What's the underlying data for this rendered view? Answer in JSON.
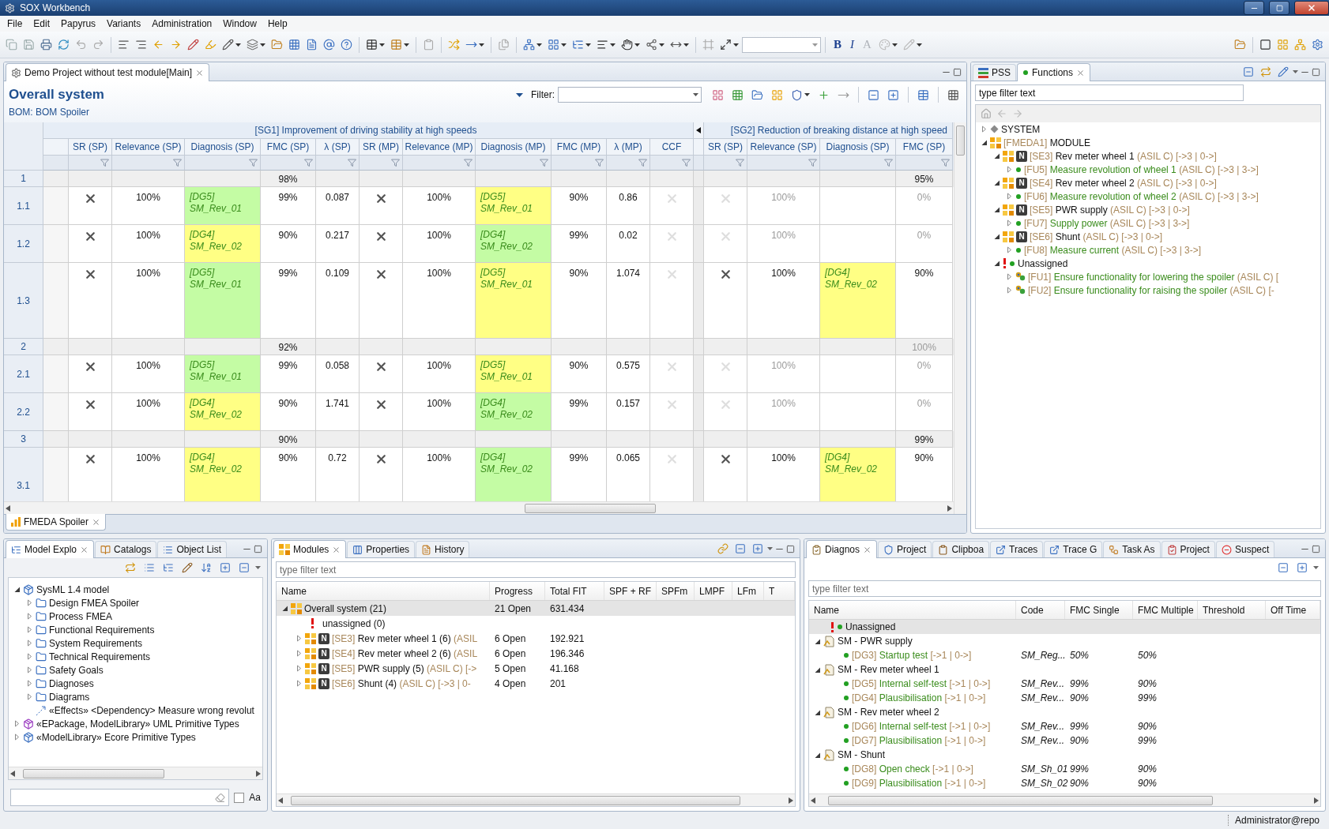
{
  "window": {
    "title": "SOX Workbench"
  },
  "menu": [
    "File",
    "Edit",
    "Papyrus",
    "Variants",
    "Administration",
    "Window",
    "Help"
  ],
  "toolbar": {
    "format_buttons": [
      {
        "label": "B",
        "disabled": false
      },
      {
        "label": "I",
        "disabled": false
      },
      {
        "label": "A",
        "disabled": true
      }
    ]
  },
  "editor": {
    "tab": {
      "label": "Demo Project without test module[Main]",
      "selected": true
    },
    "title": "Overall system",
    "filter_label": "Filter:",
    "bom": "BOM: BOM Spoiler",
    "groups": [
      {
        "title": "[SG1] Improvement of driving stability at high speeds",
        "columns": [
          "SR (SP)",
          "Relevance (SP)",
          "Diagnosis (SP)",
          "FMC (SP)",
          "λ (SP)",
          "SR (MP)",
          "Relevance (MP)",
          "Diagnosis (MP)",
          "FMC (MP)",
          "λ  (MP)",
          "CCF"
        ]
      },
      {
        "title": "[SG2] Reduction of breaking distance at high speed",
        "columns": [
          "SR (SP)",
          "Relevance (SP)",
          "Diagnosis (SP)",
          "FMC (SP)"
        ]
      }
    ],
    "rows": [
      {
        "id": "1",
        "kind": "group",
        "cells": [
          [
            null,
            null,
            null,
            {
              "kind": "text",
              "text": "98%",
              "disabled": false
            },
            null,
            null,
            null,
            null,
            null,
            null,
            null
          ],
          [
            null,
            null,
            null,
            {
              "kind": "text",
              "text": "95%",
              "disabled": false
            }
          ]
        ]
      },
      {
        "id": "1.1",
        "kind": "item",
        "tall": false,
        "cells": [
          [
            {
              "kind": "cross",
              "disabled": false
            },
            {
              "kind": "text",
              "text": "100%",
              "disabled": false
            },
            {
              "kind": "diagnosis",
              "code": "[DG5]",
              "name": "SM_Rev_01",
              "color": "#c4fca4"
            },
            {
              "kind": "text",
              "text": "99%",
              "disabled": false
            },
            {
              "kind": "text",
              "text": "0.087",
              "disabled": false
            },
            {
              "kind": "cross",
              "disabled": false
            },
            {
              "kind": "text",
              "text": "100%",
              "disabled": false
            },
            {
              "kind": "diagnosis",
              "code": "[DG5]",
              "name": "SM_Rev_01",
              "color": "#ffff84"
            },
            {
              "kind": "text",
              "text": "90%",
              "disabled": false
            },
            {
              "kind": "text",
              "text": "0.86",
              "disabled": false
            },
            {
              "kind": "cross",
              "disabled": true
            }
          ],
          [
            {
              "kind": "cross",
              "disabled": true
            },
            {
              "kind": "text",
              "text": "100%",
              "disabled": true
            },
            null,
            {
              "kind": "text",
              "text": "0%",
              "disabled": true
            }
          ]
        ]
      },
      {
        "id": "1.2",
        "kind": "item",
        "tall": false,
        "cells": [
          [
            {
              "kind": "cross",
              "disabled": false
            },
            {
              "kind": "text",
              "text": "100%",
              "disabled": false
            },
            {
              "kind": "diagnosis",
              "code": "[DG4]",
              "name": "SM_Rev_02",
              "color": "#ffff84"
            },
            {
              "kind": "text",
              "text": "90%",
              "disabled": false
            },
            {
              "kind": "text",
              "text": "0.217",
              "disabled": false
            },
            {
              "kind": "cross",
              "disabled": false
            },
            {
              "kind": "text",
              "text": "100%",
              "disabled": false
            },
            {
              "kind": "diagnosis",
              "code": "[DG4]",
              "name": "SM_Rev_02",
              "color": "#c4fca4"
            },
            {
              "kind": "text",
              "text": "99%",
              "disabled": false
            },
            {
              "kind": "text",
              "text": "0.02",
              "disabled": false
            },
            {
              "kind": "cross",
              "disabled": true
            }
          ],
          [
            {
              "kind": "cross",
              "disabled": true
            },
            {
              "kind": "text",
              "text": "100%",
              "disabled": true
            },
            null,
            {
              "kind": "text",
              "text": "0%",
              "disabled": true
            }
          ]
        ]
      },
      {
        "id": "1.3",
        "kind": "item",
        "tall": true,
        "cells": [
          [
            {
              "kind": "cross",
              "disabled": false
            },
            {
              "kind": "text",
              "text": "100%",
              "disabled": false
            },
            {
              "kind": "diagnosis",
              "code": "[DG5]",
              "name": "SM_Rev_01",
              "color": "#c4fca4"
            },
            {
              "kind": "text",
              "text": "99%",
              "disabled": false
            },
            {
              "kind": "text",
              "text": "0.109",
              "disabled": false
            },
            {
              "kind": "cross",
              "disabled": false
            },
            {
              "kind": "text",
              "text": "100%",
              "disabled": false
            },
            {
              "kind": "diagnosis",
              "code": "[DG5]",
              "name": "SM_Rev_01",
              "color": "#ffff84"
            },
            {
              "kind": "text",
              "text": "90%",
              "disabled": false
            },
            {
              "kind": "text",
              "text": "1.074",
              "disabled": false
            },
            {
              "kind": "cross",
              "disabled": true
            }
          ],
          [
            {
              "kind": "cross",
              "disabled": false
            },
            {
              "kind": "text",
              "text": "100%",
              "disabled": false
            },
            {
              "kind": "diagnosis",
              "code": "[DG4]",
              "name": "SM_Rev_02",
              "color": "#ffff84"
            },
            {
              "kind": "text",
              "text": "90%",
              "disabled": false
            }
          ]
        ]
      },
      {
        "id": "2",
        "kind": "group",
        "cells": [
          [
            null,
            null,
            null,
            {
              "kind": "text",
              "text": "92%",
              "disabled": false
            },
            null,
            null,
            null,
            null,
            null,
            null,
            null
          ],
          [
            null,
            null,
            null,
            {
              "kind": "text",
              "text": "100%",
              "disabled": true
            }
          ]
        ]
      },
      {
        "id": "2.1",
        "kind": "item",
        "tall": false,
        "cells": [
          [
            {
              "kind": "cross",
              "disabled": false
            },
            {
              "kind": "text",
              "text": "100%",
              "disabled": false
            },
            {
              "kind": "diagnosis",
              "code": "[DG5]",
              "name": "SM_Rev_01",
              "color": "#c4fca4"
            },
            {
              "kind": "text",
              "text": "99%",
              "disabled": false
            },
            {
              "kind": "text",
              "text": "0.058",
              "disabled": false
            },
            {
              "kind": "cross",
              "disabled": false
            },
            {
              "kind": "text",
              "text": "100%",
              "disabled": false
            },
            {
              "kind": "diagnosis",
              "code": "[DG5]",
              "name": "SM_Rev_01",
              "color": "#ffff84"
            },
            {
              "kind": "text",
              "text": "90%",
              "disabled": false
            },
            {
              "kind": "text",
              "text": "0.575",
              "disabled": false
            },
            {
              "kind": "cross",
              "disabled": true
            }
          ],
          [
            {
              "kind": "cross",
              "disabled": true
            },
            {
              "kind": "text",
              "text": "100%",
              "disabled": true
            },
            null,
            {
              "kind": "text",
              "text": "0%",
              "disabled": true
            }
          ]
        ]
      },
      {
        "id": "2.2",
        "kind": "item",
        "tall": false,
        "cells": [
          [
            {
              "kind": "cross",
              "disabled": false
            },
            {
              "kind": "text",
              "text": "100%",
              "disabled": false
            },
            {
              "kind": "diagnosis",
              "code": "[DG4]",
              "name": "SM_Rev_02",
              "color": "#ffff84"
            },
            {
              "kind": "text",
              "text": "90%",
              "disabled": false
            },
            {
              "kind": "text",
              "text": "1.741",
              "disabled": false
            },
            {
              "kind": "cross",
              "disabled": false
            },
            {
              "kind": "text",
              "text": "100%",
              "disabled": false
            },
            {
              "kind": "diagnosis",
              "code": "[DG4]",
              "name": "SM_Rev_02",
              "color": "#c4fca4"
            },
            {
              "kind": "text",
              "text": "99%",
              "disabled": false
            },
            {
              "kind": "text",
              "text": "0.157",
              "disabled": false
            },
            {
              "kind": "cross",
              "disabled": true
            }
          ],
          [
            {
              "kind": "cross",
              "disabled": true
            },
            {
              "kind": "text",
              "text": "100%",
              "disabled": true
            },
            null,
            {
              "kind": "text",
              "text": "0%",
              "disabled": true
            }
          ]
        ]
      },
      {
        "id": "3",
        "kind": "group",
        "cells": [
          [
            null,
            null,
            null,
            {
              "kind": "text",
              "text": "90%",
              "disabled": false
            },
            null,
            null,
            null,
            null,
            null,
            null,
            null
          ],
          [
            null,
            null,
            null,
            {
              "kind": "text",
              "text": "99%",
              "disabled": false
            }
          ]
        ]
      },
      {
        "id": "3.1",
        "kind": "item",
        "tall": true,
        "cells": [
          [
            {
              "kind": "cross",
              "disabled": false
            },
            {
              "kind": "text",
              "text": "100%",
              "disabled": false
            },
            {
              "kind": "diagnosis",
              "code": "[DG4]",
              "name": "SM_Rev_02",
              "color": "#ffff84"
            },
            {
              "kind": "text",
              "text": "90%",
              "disabled": false
            },
            {
              "kind": "text",
              "text": "0.72",
              "disabled": false
            },
            {
              "kind": "cross",
              "disabled": false
            },
            {
              "kind": "text",
              "text": "100%",
              "disabled": false
            },
            {
              "kind": "diagnosis",
              "code": "[DG4]",
              "name": "SM_Rev_02",
              "color": "#c4fca4"
            },
            {
              "kind": "text",
              "text": "99%",
              "disabled": false
            },
            {
              "kind": "text",
              "text": "0.065",
              "disabled": false
            },
            {
              "kind": "cross",
              "disabled": true
            }
          ],
          [
            {
              "kind": "cross",
              "disabled": false
            },
            {
              "kind": "text",
              "text": "100%",
              "disabled": false
            },
            {
              "kind": "diagnosis",
              "code": "[DG4]",
              "name": "SM_Rev_02",
              "color": "#ffff84"
            },
            {
              "kind": "text",
              "text": "90%",
              "disabled": false
            }
          ]
        ]
      }
    ],
    "bottom_tab": {
      "label": "FMEDA Spoiler",
      "selected": true
    }
  },
  "functions_panel": {
    "tabs": [
      {
        "label": "PSS",
        "selected": false
      },
      {
        "label": "Functions",
        "selected": true
      }
    ],
    "filter": "type filter text",
    "tree": [
      {
        "kind": "system",
        "name": "SYSTEM",
        "expanded": false
      },
      {
        "kind": "module",
        "code": "[FMEDA1]",
        "name": "MODULE",
        "expanded": true,
        "children": [
          {
            "kind": "element",
            "badge": "N",
            "code": "[SE3]",
            "name": "Rev meter wheel 1",
            "suffix": "(ASIL C) [->3 | 0->]",
            "expanded": true,
            "children": [
              {
                "kind": "function",
                "code": "[FU5]",
                "name": "Measure revolution of wheel 1",
                "suffix": "(ASIL C) [->3 | 3->]",
                "expanded": false
              }
            ]
          },
          {
            "kind": "element",
            "badge": "N",
            "code": "[SE4]",
            "name": "Rev meter wheel 2",
            "suffix": "(ASIL C) [->3 | 0->]",
            "expanded": true,
            "children": [
              {
                "kind": "function",
                "code": "[FU6]",
                "name": "Measure revolution of wheel 2",
                "suffix": "(ASIL C) [->3 | 3->]",
                "expanded": false
              }
            ]
          },
          {
            "kind": "element",
            "badge": "N",
            "code": "[SE5]",
            "name": "PWR supply",
            "suffix": "(ASIL C) [->3 | 0->]",
            "expanded": true,
            "children": [
              {
                "kind": "function",
                "code": "[FU7]",
                "name": "Supply power",
                "suffix": "(ASIL C) [->3 | 3->]",
                "expanded": false
              }
            ]
          },
          {
            "kind": "element",
            "badge": "N",
            "code": "[SE6]",
            "name": "Shunt",
            "suffix": "(ASIL C) [->3 | 0->]",
            "expanded": true,
            "children": [
              {
                "kind": "function",
                "code": "[FU8]",
                "name": "Measure current",
                "suffix": "(ASIL C) [->3 | 3->]",
                "expanded": false
              }
            ]
          },
          {
            "kind": "unassigned",
            "name": "Unassigned",
            "expanded": true,
            "children": [
              {
                "kind": "function_unassigned",
                "code": "[FU1]",
                "name": "Ensure functionality for lowering the spoiler",
                "suffix": "(ASIL C) [",
                "expanded": false
              },
              {
                "kind": "function_unassigned",
                "code": "[FU2]",
                "name": "Ensure functionality for raising the spoiler",
                "suffix": "(ASIL C) [-",
                "expanded": false
              }
            ]
          }
        ]
      }
    ]
  },
  "model_explorer": {
    "tabs": [
      {
        "label": "Model Explo",
        "selected": true
      },
      {
        "label": "Catalogs",
        "selected": false
      },
      {
        "label": "Object List",
        "selected": false
      }
    ],
    "tree": [
      {
        "kind": "model",
        "label": "SysML 1.4 model",
        "expanded": true,
        "children": [
          {
            "kind": "folder",
            "label": "Design FMEA Spoiler",
            "expanded": false
          },
          {
            "kind": "folder",
            "label": "Process FMEA",
            "expanded": false
          },
          {
            "kind": "folder",
            "label": "Functional Requirements",
            "expanded": false
          },
          {
            "kind": "folder",
            "label": "System Requirements",
            "expanded": false
          },
          {
            "kind": "folder",
            "label": "Technical Requirements",
            "expanded": false
          },
          {
            "kind": "folder",
            "label": "Safety Goals",
            "expanded": false
          },
          {
            "kind": "folder",
            "label": "Diagnoses",
            "expanded": false
          },
          {
            "kind": "folder",
            "label": "Diagrams",
            "expanded": false
          },
          {
            "kind": "dependency",
            "label": "«Effects» <Dependency> Measure wrong revolut"
          }
        ]
      },
      {
        "kind": "library",
        "label": "«EPackage, ModelLibrary» UML Primitive Types",
        "expanded": false
      },
      {
        "kind": "model",
        "label": "«ModelLibrary» Ecore Primitive Types",
        "expanded": false
      }
    ],
    "case_option": {
      "label": "Aa",
      "checked": false
    }
  },
  "modules": {
    "tabs": [
      {
        "label": "Modules",
        "selected": true
      },
      {
        "label": "Properties",
        "selected": false
      },
      {
        "label": "History",
        "selected": false
      }
    ],
    "placeholder": "type filter text",
    "columns": [
      "Name",
      "Progress",
      "Total FIT",
      "SPF + RF",
      "SPFm",
      "LMPF",
      "LFm",
      "T"
    ],
    "rows": [
      {
        "kind": "overall",
        "name": "Overall system  (21)",
        "progress": "21 Open",
        "fit": "631.434",
        "expanded": true,
        "selected": true,
        "children": [
          {
            "kind": "unassigned",
            "name": "unassigned  (0)",
            "selected": false
          },
          {
            "kind": "element",
            "badge": "N",
            "code": "[SE3]",
            "name": "Rev meter wheel 1  (6)",
            "suffix": "(ASIL",
            "progress": "6 Open",
            "fit": "192.921",
            "expanded": false,
            "selected": false
          },
          {
            "kind": "element",
            "badge": "N",
            "code": "[SE4]",
            "name": "Rev meter wheel 2  (6)",
            "suffix": "(ASIL",
            "progress": "6 Open",
            "fit": "196.346",
            "expanded": false,
            "selected": false
          },
          {
            "kind": "element",
            "badge": "N",
            "code": "[SE5]",
            "name": "PWR supply  (5)",
            "suffix": "(ASIL C) [->",
            "progress": "5 Open",
            "fit": "41.168",
            "expanded": false,
            "selected": false
          },
          {
            "kind": "element",
            "badge": "N",
            "code": "[SE6]",
            "name": "Shunt  (4)",
            "suffix": "(ASIL C) [->3 | 0-",
            "progress": "4 Open",
            "fit": "201",
            "expanded": false,
            "selected": false
          }
        ]
      }
    ]
  },
  "diagnoses": {
    "tabs": [
      {
        "label": "Diagnos",
        "selected": true
      },
      {
        "label": "Project",
        "selected": false
      },
      {
        "label": "Clipboa",
        "selected": false
      },
      {
        "label": "Traces",
        "selected": false
      },
      {
        "label": "Trace G",
        "selected": false
      },
      {
        "label": "Task As",
        "selected": false
      },
      {
        "label": "Project",
        "selected": false
      },
      {
        "label": "Suspect",
        "selected": false
      }
    ],
    "placeholder": "type filter text",
    "columns": [
      "Name",
      "Code",
      "FMC Single",
      "FMC Multiple",
      "Threshold",
      "Off Time"
    ],
    "rows": [
      {
        "kind": "unassigned",
        "name": "Unassigned",
        "selected": true
      },
      {
        "kind": "group",
        "name": "SM - PWR supply",
        "expanded": true,
        "selected": false,
        "children": [
          {
            "kind": "diagnosis",
            "code": "[DG3]",
            "name": "Startup test",
            "suffix": "[->1 | 0->]",
            "code_value": "SM_Reg...",
            "fmc_single": "50%",
            "fmc_multiple": "50%",
            "selected": false
          }
        ]
      },
      {
        "kind": "group",
        "name": "SM - Rev meter wheel 1",
        "expanded": true,
        "selected": false,
        "children": [
          {
            "kind": "diagnosis",
            "code": "[DG5]",
            "name": "Internal self-test",
            "suffix": "[->1 | 0->]",
            "code_value": "SM_Rev...",
            "fmc_single": "99%",
            "fmc_multiple": "90%",
            "selected": false
          },
          {
            "kind": "diagnosis",
            "code": "[DG4]",
            "name": "Plausibilisation",
            "suffix": "[->1 | 0->]",
            "code_value": "SM_Rev...",
            "fmc_single": "90%",
            "fmc_multiple": "99%",
            "selected": false
          }
        ]
      },
      {
        "kind": "group",
        "name": "SM - Rev meter wheel 2",
        "expanded": true,
        "selected": false,
        "children": [
          {
            "kind": "diagnosis",
            "code": "[DG6]",
            "name": "Internal self-test",
            "suffix": "[->1 | 0->]",
            "code_value": "SM_Rev...",
            "fmc_single": "99%",
            "fmc_multiple": "90%",
            "selected": false
          },
          {
            "kind": "diagnosis",
            "code": "[DG7]",
            "name": "Plausibilisation",
            "suffix": "[->1 | 0->]",
            "code_value": "SM_Rev...",
            "fmc_single": "90%",
            "fmc_multiple": "99%",
            "selected": false
          }
        ]
      },
      {
        "kind": "group",
        "name": "SM - Shunt",
        "expanded": true,
        "selected": false,
        "children": [
          {
            "kind": "diagnosis",
            "code": "[DG8]",
            "name": "Open check",
            "suffix": "[->1 | 0->]",
            "code_value": "SM_Sh_01",
            "fmc_single": "99%",
            "fmc_multiple": "90%",
            "selected": false
          },
          {
            "kind": "diagnosis",
            "code": "[DG9]",
            "name": "Plausibilisation",
            "suffix": "[->1 | 0->]",
            "code_value": "SM_Sh_02",
            "fmc_single": "90%",
            "fmc_multiple": "90%",
            "selected": false
          }
        ]
      }
    ]
  },
  "status_bar": {
    "user": "Administrator@repo"
  }
}
